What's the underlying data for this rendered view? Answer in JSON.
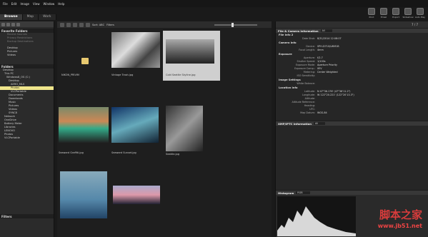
{
  "menu": [
    "File",
    "Edit",
    "Image",
    "View",
    "Window",
    "Help"
  ],
  "toolbar_right": [
    {
      "label": "Print",
      "icon": "print-icon"
    },
    {
      "label": "Email",
      "icon": "email-icon"
    },
    {
      "label": "Export",
      "icon": "export-icon"
    },
    {
      "label": "Slideshow",
      "icon": "slideshow-icon"
    },
    {
      "label": "Auto Play",
      "icon": "auto-play-icon"
    }
  ],
  "tabs": [
    "Browse",
    "Map",
    "Work"
  ],
  "left": {
    "favorites_title": "Favorite Folders",
    "favorites": [
      "Recent Sources",
      "Privacy Restrictions",
      "Backup Destinations"
    ],
    "libraries": [
      "Desktop",
      "Pictures",
      "Videos"
    ],
    "folders_title": "Folders",
    "tree": [
      "Desktop",
      "This PC",
      "Windows8_OS (C:)",
      "Desktop",
      "AERO_MLS",
      "Photos",
      "VLCPortable",
      "Documents",
      "Downloads",
      "Music",
      "Pictures",
      "Videos",
      "SYNC8",
      "Network",
      "OneDrive",
      "Battery Meter",
      "Libraries",
      "LENOVO",
      "Photos",
      "VLCPortable"
    ],
    "filters_title": "Filters"
  },
  "grid": {
    "sort_label": "Sort: ABC",
    "filters_label": "Filters",
    "items": [
      {
        "caption": "NIKON_PRIVIM",
        "kind": "folder"
      },
      {
        "caption": "Vintage Trash.jpg",
        "kind": "photo"
      },
      {
        "caption": "Cold Seattle Skyline.jpg",
        "kind": "photo"
      },
      {
        "caption": "Seaward Graffiti.jpg",
        "kind": "photo"
      },
      {
        "caption": "Seaward Sunset.jpg",
        "kind": "photo"
      },
      {
        "caption": "Seattle.jpg",
        "kind": "photo"
      },
      {
        "caption": "",
        "kind": "photo"
      },
      {
        "caption": "",
        "kind": "photo"
      }
    ]
  },
  "right": {
    "counter": "7 / 7",
    "file_camera_title": "File & Camera Information",
    "file_camera_select": "All",
    "file_info_title": "File Info 2",
    "file_info": [
      {
        "k": "Date Shot:",
        "v": "8/31/2014 12:08:07"
      }
    ],
    "camera_info_title": "Camera Info",
    "camera_info": [
      {
        "k": "Device:",
        "v": "SPH-D710/LWM1B"
      },
      {
        "k": "Focal Length:",
        "v": "4mm"
      }
    ],
    "exposure_title": "Exposure",
    "exposure": [
      {
        "k": "Aperture:",
        "v": "f/2.7"
      },
      {
        "k": "Shutter Speed:",
        "v": "1/100s"
      },
      {
        "k": "Exposure Mode:",
        "v": "Aperture Priority"
      },
      {
        "k": "Exposure Comp.:",
        "v": "0EV"
      },
      {
        "k": "Metering:",
        "v": "Center Weighted"
      },
      {
        "k": "ISO Sensitivity:",
        "v": ""
      }
    ],
    "image_settings_title": "Image Settings",
    "image_settings": [
      {
        "k": "White Balance:",
        "v": ""
      }
    ],
    "location_title": "Location Info",
    "location": [
      {
        "k": "Latitude:",
        "v": "N 47°36.176' (47°36'11.2\")"
      },
      {
        "k": "Longitude:",
        "v": "W 122°20.221' (122°20'13.3\")"
      },
      {
        "k": "Altitude:",
        "v": ""
      },
      {
        "k": "Altitude Reference:",
        "v": ""
      },
      {
        "k": "Heading:",
        "v": ""
      },
      {
        "k": "UTC:",
        "v": ""
      },
      {
        "k": "Map Datum:",
        "v": "WGS-84"
      }
    ],
    "xmp_title": "XMP/IPTC Information",
    "xmp_select": "All",
    "histogram_title": "Histogram",
    "histogram_select": "RGB"
  },
  "watermark": {
    "text": "脚本之家",
    "url": "www.jb51.net"
  }
}
